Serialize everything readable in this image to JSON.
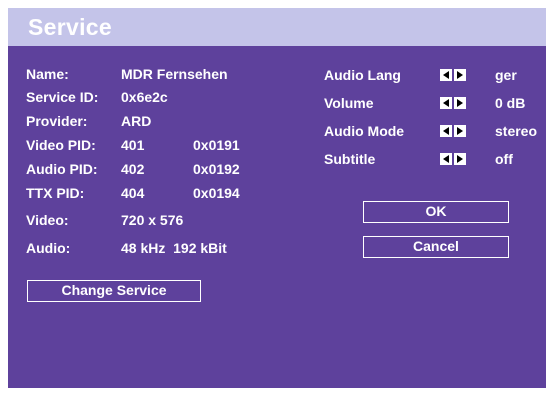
{
  "window": {
    "title": "Service"
  },
  "info": {
    "name_label": "Name:",
    "name_value": "MDR Fernsehen",
    "service_id_label": "Service ID:",
    "service_id_value": "0x6e2c",
    "provider_label": "Provider:",
    "provider_value": "ARD",
    "video_pid_label": "Video PID:",
    "video_pid_dec": "401",
    "video_pid_hex": "0x0191",
    "audio_pid_label": "Audio PID:",
    "audio_pid_dec": "402",
    "audio_pid_hex": "0x0192",
    "ttx_pid_label": "TTX PID:",
    "ttx_pid_dec": "404",
    "ttx_pid_hex": "0x0194",
    "video_label": "Video:",
    "video_value": "720 x 576",
    "audio_label": "Audio:",
    "audio_value": "48 kHz  192 kBit"
  },
  "settings": [
    {
      "label": "Audio Lang",
      "value": "ger",
      "icon": "left-right-arrows-icon"
    },
    {
      "label": "Volume",
      "value": "0 dB",
      "icon": "left-right-arrows-icon"
    },
    {
      "label": "Audio Mode",
      "value": "stereo",
      "icon": "left-right-arrows-icon"
    },
    {
      "label": "Subtitle",
      "value": "off",
      "icon": "left-right-arrows-icon"
    }
  ],
  "buttons": {
    "ok": "OK",
    "cancel": "Cancel",
    "change_service": "Change Service"
  },
  "colors": {
    "background": "#5e419c",
    "title_bar": "#c4c4e9",
    "text": "#ffffff"
  }
}
